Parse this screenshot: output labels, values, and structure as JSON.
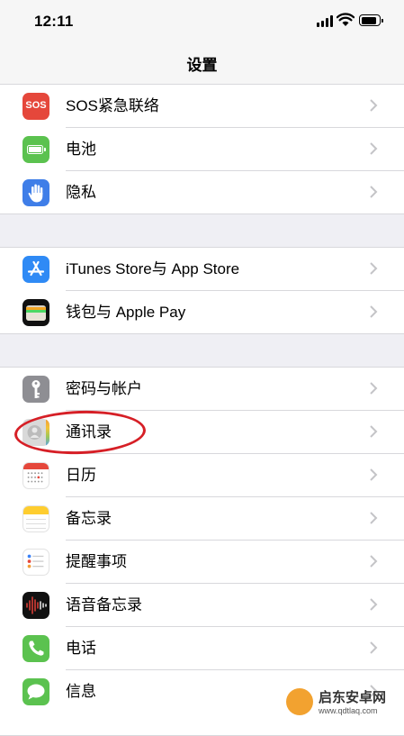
{
  "status_bar": {
    "time": "12:11"
  },
  "nav": {
    "title": "设置"
  },
  "groups": [
    {
      "rows": [
        {
          "label": "SOS紧急联络",
          "icon": "sos-icon",
          "icon_text": "SOS",
          "color": "#e5473b"
        },
        {
          "label": "电池",
          "icon": "battery-icon",
          "color": "#5bc24f"
        },
        {
          "label": "隐私",
          "icon": "hand-icon",
          "color": "#3f7ee8"
        }
      ]
    },
    {
      "rows": [
        {
          "label": "iTunes Store与 App Store",
          "icon": "app-store-icon",
          "color": "#2f8af5"
        },
        {
          "label": "钱包与 Apple Pay",
          "icon": "wallet-icon",
          "color": "#111111"
        }
      ]
    },
    {
      "rows": [
        {
          "label": "密码与帐户",
          "icon": "key-icon",
          "color": "#8e8e93"
        },
        {
          "label": "通讯录",
          "icon": "contacts-icon",
          "color": "#d9d9d9"
        },
        {
          "label": "日历",
          "icon": "calendar-icon",
          "color": "#ffffff"
        },
        {
          "label": "备忘录",
          "icon": "notes-icon",
          "color": "#fecd2f"
        },
        {
          "label": "提醒事项",
          "icon": "reminders-icon",
          "color": "#ffffff"
        },
        {
          "label": "语音备忘录",
          "icon": "voice-memos-icon",
          "color": "#111111"
        },
        {
          "label": "电话",
          "icon": "phone-icon",
          "color": "#5bc24f"
        },
        {
          "label": "信息",
          "icon": "messages-icon",
          "color": "#5bc24f"
        }
      ]
    }
  ],
  "watermark": {
    "title": "启东安卓网",
    "url": "www.qdtlaq.com"
  }
}
